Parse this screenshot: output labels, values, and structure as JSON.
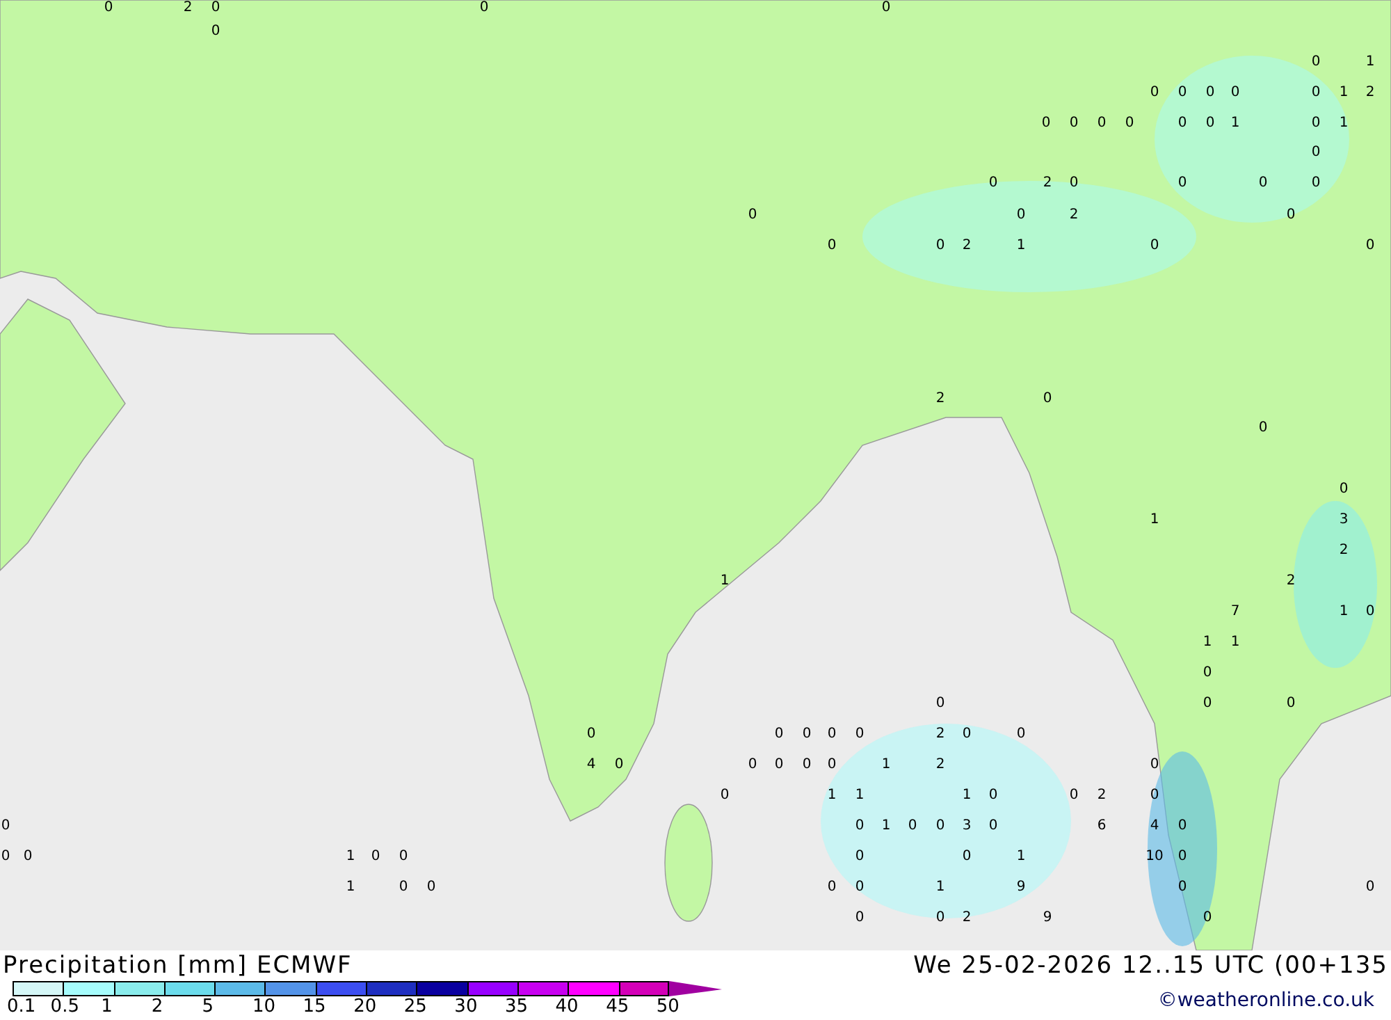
{
  "map": {
    "values": [
      "0",
      "2",
      "0",
      "0",
      "0",
      "0",
      "0",
      "1",
      "0",
      "0",
      "0",
      "0",
      "0",
      "1",
      "2",
      "0",
      "0",
      "0",
      "0",
      "0",
      "0",
      "1",
      "0",
      "1",
      "0",
      "0",
      "2",
      "0",
      "0",
      "0",
      "0",
      "0",
      "0",
      "2",
      "0",
      "0",
      "0",
      "2",
      "1",
      "0",
      "0",
      "2",
      "0",
      "0",
      "0",
      "1",
      "3",
      "2",
      "1",
      "2",
      "7",
      "1",
      "0",
      "1",
      "1",
      "0",
      "0",
      "0",
      "0",
      "0",
      "0",
      "0",
      "0",
      "0",
      "2",
      "0",
      "0",
      "4",
      "0",
      "0",
      "0",
      "0",
      "0",
      "1",
      "2",
      "0",
      "0",
      "1",
      "1",
      "1",
      "0",
      "0",
      "2",
      "0",
      "0",
      "0",
      "1",
      "0",
      "0",
      "3",
      "0",
      "6",
      "4",
      "0",
      "0",
      "0",
      "1",
      "0",
      "0",
      "0",
      "0",
      "1",
      "10",
      "0",
      "1",
      "0",
      "0",
      "0",
      "0",
      "1",
      "9",
      "0",
      "0",
      "0",
      "0",
      "2",
      "9",
      "0"
    ]
  },
  "footer": {
    "title": "Precipitation [mm] ECMWF",
    "datetime": "We 25-02-2026 12..15 UTC (00+135",
    "credit": "©weatheronline.co.uk"
  },
  "legend": {
    "swatches": [
      {
        "color": "#d5f7f7"
      },
      {
        "color": "#a6fcfc"
      },
      {
        "color": "#8aecec"
      },
      {
        "color": "#6cdcec"
      },
      {
        "color": "#5cbae8"
      },
      {
        "color": "#5393e8"
      },
      {
        "color": "#3c4ef0"
      },
      {
        "color": "#1e2ec0"
      },
      {
        "color": "#0a00a0"
      },
      {
        "color": "#9800ff"
      },
      {
        "color": "#c800f0"
      },
      {
        "color": "#ff00ff"
      },
      {
        "color": "#d400b8"
      },
      {
        "color": "#a000a0",
        "kind": "arrow"
      }
    ],
    "ticks": [
      "0.1",
      "0.5",
      "1",
      "2",
      "5",
      "10",
      "15",
      "20",
      "25",
      "30",
      "35",
      "40",
      "45",
      "50"
    ]
  }
}
